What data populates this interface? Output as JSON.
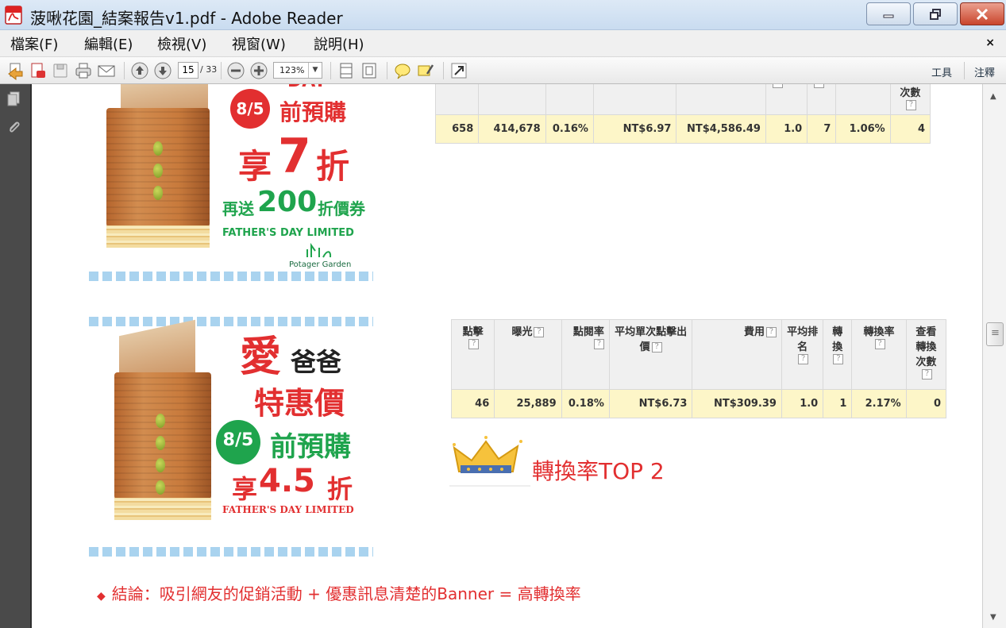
{
  "window": {
    "title": "菠啾花園_結案報告v1.pdf - Adobe Reader",
    "icon": "pdf-icon",
    "controls": [
      "minimize-icon",
      "restore-icon",
      "close-icon"
    ]
  },
  "menu": {
    "items": [
      "檔案(F)",
      "編輯(E)",
      "檢視(V)",
      "視窗(W)",
      "說明(H)"
    ],
    "close_glyph": "×"
  },
  "toolbar": {
    "page_current": "15",
    "page_total": "/ 33",
    "zoom": "123%",
    "tools_label": "工具",
    "comment_label": "注釋"
  },
  "banner1": {
    "date": "8/5",
    "preorder": "前預購",
    "discount_prefix": "享",
    "discount_number": "7",
    "discount_suffix": "折",
    "coupon_prefix": "再送",
    "coupon_number": "200",
    "coupon_suffix": "折價券",
    "event": "FATHER'S DAY LIMITED",
    "brand": "Potager Garden",
    "top_cut_text": "DAY"
  },
  "banner2": {
    "love": "愛",
    "dad": "爸爸",
    "special": "特惠價",
    "date": "8/5",
    "preorder": "前預購",
    "discount_prefix": "享",
    "discount_number": "4.5",
    "discount_suffix": "折",
    "event": "FATHER'S DAY LIMITED"
  },
  "table1": {
    "partial_header": "次數",
    "values": [
      "658",
      "414,678",
      "0.16%",
      "NT$6.97",
      "NT$4,586.49",
      "1.0",
      "7",
      "1.06%",
      "4"
    ]
  },
  "table2": {
    "headers": [
      "點擊",
      "曝光",
      "點閱率",
      "平均單次點擊出價",
      "費用",
      "平均排名",
      "轉換",
      "轉換率",
      "查看轉換次數"
    ],
    "values": [
      "46",
      "25,889",
      "0.18%",
      "NT$6.73",
      "NT$309.39",
      "1.0",
      "1",
      "2.17%",
      "0"
    ],
    "help_glyph": "?"
  },
  "callout": {
    "text": "轉換率TOP 2",
    "icon": "crown-icon"
  },
  "conclusion": {
    "bullet": "◆",
    "text": "結論：吸引網友的促銷活動 + 優惠訊息清楚的Banner = 高轉換率"
  }
}
